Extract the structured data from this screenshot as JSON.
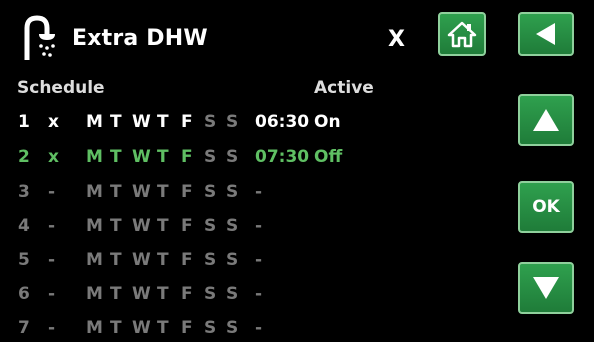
{
  "header": {
    "title": "Extra DHW",
    "close_label": "X"
  },
  "table": {
    "schedule_header": "Schedule",
    "active_header": "Active",
    "rows": [
      {
        "num": "1",
        "mark": "x",
        "days": [
          "M",
          "T",
          "W",
          "T",
          "F",
          "S",
          "S"
        ],
        "day_states": [
          "on",
          "on",
          "on",
          "on",
          "on",
          "off",
          "off"
        ],
        "time": "06:30",
        "active": "On",
        "state": "set"
      },
      {
        "num": "2",
        "mark": "x",
        "days": [
          "M",
          "T",
          "W",
          "T",
          "F",
          "S",
          "S"
        ],
        "day_states": [
          "on",
          "on",
          "on",
          "on",
          "on",
          "off",
          "off"
        ],
        "time": "07:30",
        "active": "Off",
        "state": "selected"
      },
      {
        "num": "3",
        "mark": "-",
        "days": [
          "M",
          "T",
          "W",
          "T",
          "F",
          "S",
          "S"
        ],
        "day_states": [
          "off",
          "off",
          "off",
          "off",
          "off",
          "off",
          "off"
        ],
        "time": "-",
        "active": "",
        "state": "empty"
      },
      {
        "num": "4",
        "mark": "-",
        "days": [
          "M",
          "T",
          "W",
          "T",
          "F",
          "S",
          "S"
        ],
        "day_states": [
          "off",
          "off",
          "off",
          "off",
          "off",
          "off",
          "off"
        ],
        "time": "-",
        "active": "",
        "state": "empty"
      },
      {
        "num": "5",
        "mark": "-",
        "days": [
          "M",
          "T",
          "W",
          "T",
          "F",
          "S",
          "S"
        ],
        "day_states": [
          "off",
          "off",
          "off",
          "off",
          "off",
          "off",
          "off"
        ],
        "time": "-",
        "active": "",
        "state": "empty"
      },
      {
        "num": "6",
        "mark": "-",
        "days": [
          "M",
          "T",
          "W",
          "T",
          "F",
          "S",
          "S"
        ],
        "day_states": [
          "off",
          "off",
          "off",
          "off",
          "off",
          "off",
          "off"
        ],
        "time": "-",
        "active": "",
        "state": "empty"
      },
      {
        "num": "7",
        "mark": "-",
        "days": [
          "M",
          "T",
          "W",
          "T",
          "F",
          "S",
          "S"
        ],
        "day_states": [
          "off",
          "off",
          "off",
          "off",
          "off",
          "off",
          "off"
        ],
        "time": "-",
        "active": "",
        "state": "empty"
      }
    ]
  },
  "buttons": {
    "home_icon": "home-icon",
    "back_icon": "arrow-left-icon",
    "up_icon": "arrow-up-icon",
    "ok_label": "OK",
    "down_icon": "arrow-down-icon"
  },
  "colors": {
    "background": "#000000",
    "button_green": "#2a9447",
    "selected_row": "#5fbf63",
    "inactive_text": "#7a7a7a",
    "text": "#ffffff"
  }
}
